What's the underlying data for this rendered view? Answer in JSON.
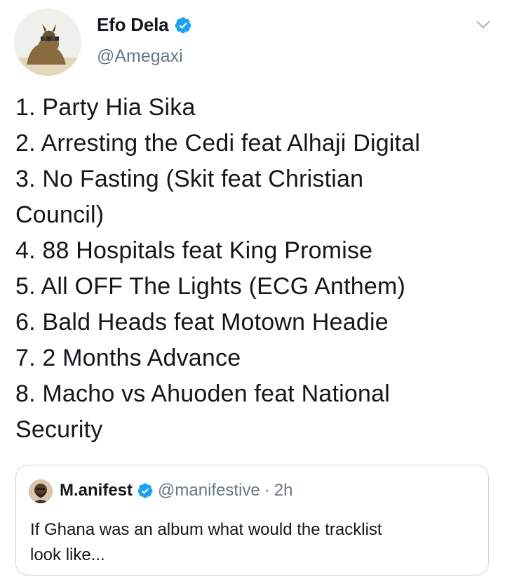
{
  "author": {
    "display_name": "Efo Dela",
    "handle": "@Amegaxi",
    "verified_icon": "verified-badge-icon",
    "avatar_icon": "avatar-image"
  },
  "menu_icon": "chevron-down-icon",
  "tweet": {
    "lines": [
      "1. Party Hia Sika",
      "2. Arresting the Cedi feat Alhaji Digital",
      "3. No Fasting (Skit feat Christian",
      "Council)",
      "4. 88 Hospitals feat King Promise",
      "5. All OFF The Lights (ECG Anthem)",
      "6. Bald Heads feat Motown Headie",
      "7. 2 Months Advance",
      "8. Macho vs Ahuoden feat National",
      "Security"
    ]
  },
  "quoted_tweet": {
    "display_name": "M.anifest",
    "handle": "@manifestive",
    "separator": "·",
    "time": "2h",
    "text_line1": "If Ghana was an album what would the tracklist",
    "text_line2": "look like..."
  },
  "colors": {
    "text": "#14171a",
    "secondary": "#657786",
    "verified": "#1da1f2",
    "border": "#ccd6dd"
  }
}
